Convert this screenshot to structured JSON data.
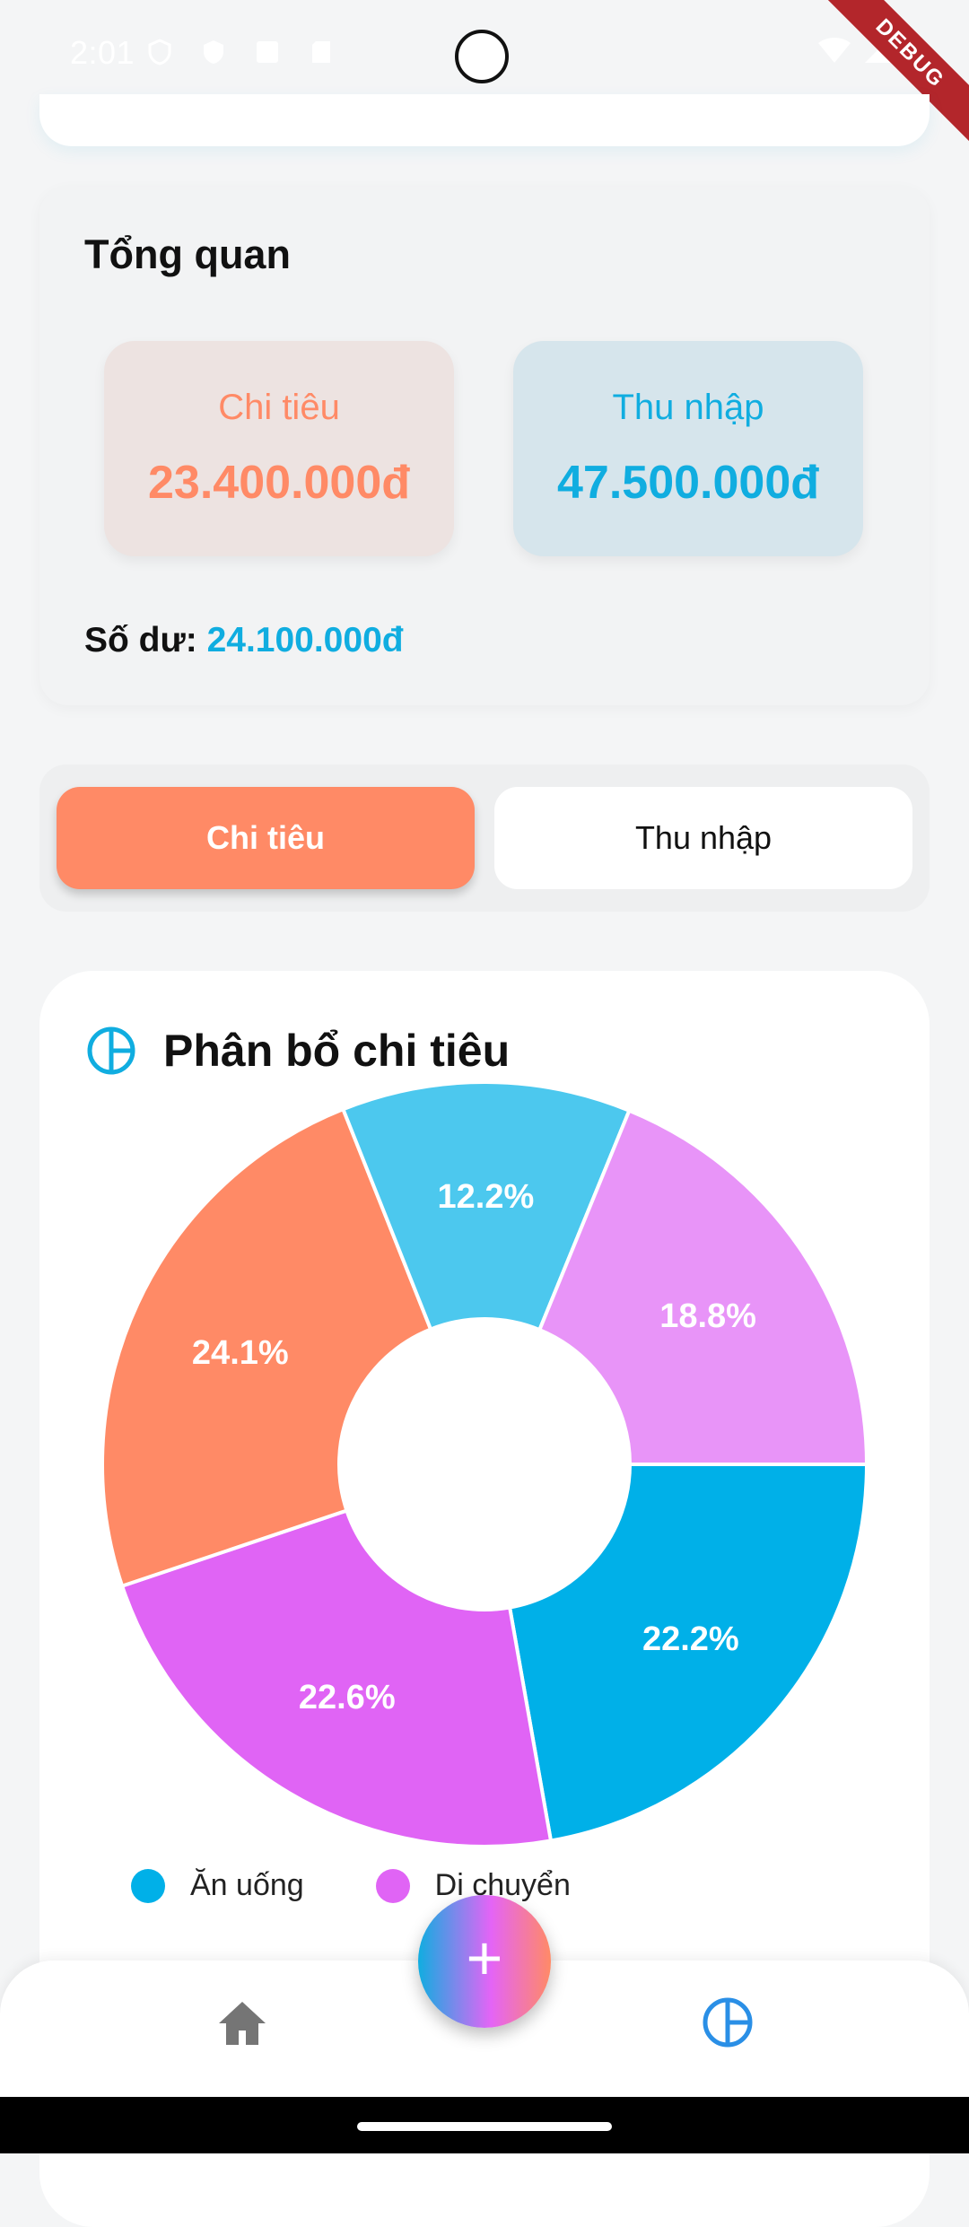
{
  "status_bar": {
    "time": "2:01",
    "debug_label": "DEBUG"
  },
  "overview": {
    "title": "Tổng quan",
    "expense_label": "Chi tiêu",
    "expense_amount": "23.400.000đ",
    "income_label": "Thu nhập",
    "income_amount": "47.500.000đ",
    "balance_label": "Số dư: ",
    "balance_amount": "24.100.000đ"
  },
  "toggle": {
    "expense": "Chi tiêu",
    "income": "Thu nhập",
    "selected": "Chi tiêu"
  },
  "chart_section": {
    "title": "Phân bổ chi tiêu",
    "icon": "pie-chart-icon"
  },
  "chart_data": {
    "type": "pie",
    "donut": true,
    "slices": [
      {
        "label": "22.2%",
        "value": 22.2,
        "color": "#00b0e8"
      },
      {
        "label": "22.6%",
        "value": 22.6,
        "color": "#e064f5"
      },
      {
        "label": "24.1%",
        "value": 24.1,
        "color": "#ff8a66"
      },
      {
        "label": "12.2%",
        "value": 12.2,
        "color": "#4cc8ee"
      },
      {
        "label": "18.8%",
        "value": 18.8,
        "color": "#e894f8"
      }
    ],
    "legend": [
      {
        "name": "Ăn uống",
        "color": "#00b0e8"
      },
      {
        "name": "Di chuyển",
        "color": "#e064f5"
      }
    ]
  },
  "bottom_nav": {
    "fab_label": "+",
    "icons": [
      "home-icon",
      "pie-chart-icon"
    ]
  },
  "colors": {
    "accent_orange": "#ff8a66",
    "accent_blue": "#10ade0"
  }
}
